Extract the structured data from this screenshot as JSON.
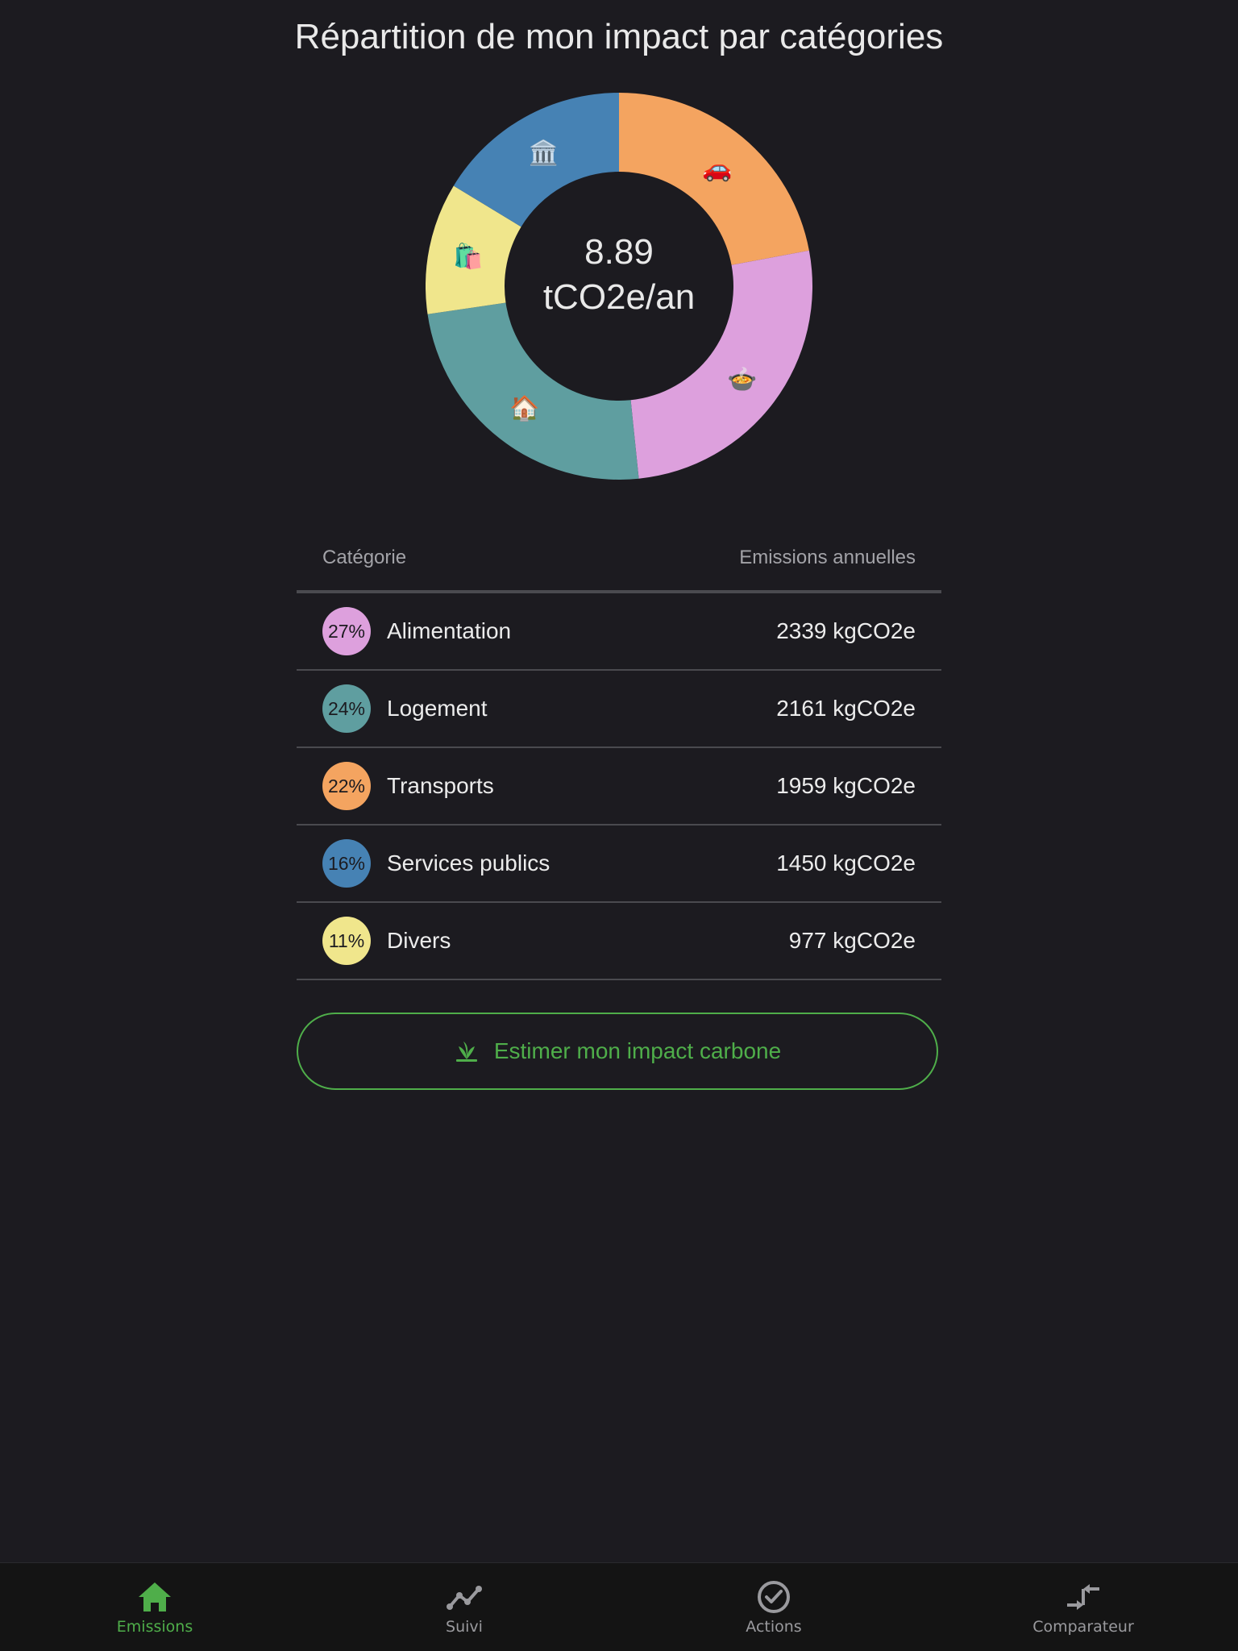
{
  "page": {
    "title": "Répartition de mon impact par catégories"
  },
  "chart_data": {
    "type": "pie",
    "total_line1": "8.89",
    "total_line2": "tCO2e/an",
    "slices": [
      {
        "name": "Transports",
        "value": 1959,
        "color": "#f4a460",
        "icon": "🚗"
      },
      {
        "name": "Alimentation",
        "value": 2339,
        "color": "#dda0dd",
        "icon": "🍲"
      },
      {
        "name": "Logement",
        "value": 2161,
        "color": "#5f9ea0",
        "icon": "🏠"
      },
      {
        "name": "Divers",
        "value": 977,
        "color": "#f0e68c",
        "icon": "🛍️"
      },
      {
        "name": "Services publics",
        "value": 1450,
        "color": "#4682b4",
        "icon": "🏛️"
      }
    ]
  },
  "table": {
    "col_category": "Catégorie",
    "col_emissions": "Emissions annuelles",
    "rows": [
      {
        "pct": "27%",
        "label": "Alimentation",
        "value": "2339 kgCO2e",
        "color": "#dda0dd"
      },
      {
        "pct": "24%",
        "label": "Logement",
        "value": "2161 kgCO2e",
        "color": "#5f9ea0"
      },
      {
        "pct": "22%",
        "label": "Transports",
        "value": "1959 kgCO2e",
        "color": "#f4a460"
      },
      {
        "pct": "16%",
        "label": "Services publics",
        "value": "1450 kgCO2e",
        "color": "#4682b4"
      },
      {
        "pct": "11%",
        "label": "Divers",
        "value": "977 kgCO2e",
        "color": "#f0e68c"
      }
    ]
  },
  "cta": {
    "label": "Estimer mon impact carbone",
    "icon": "sprout-icon",
    "color": "#4fae4a"
  },
  "nav": {
    "items": [
      {
        "label": "Emissions",
        "icon": "home-icon",
        "active": true
      },
      {
        "label": "Suivi",
        "icon": "trend-icon",
        "active": false
      },
      {
        "label": "Actions",
        "icon": "check-circle-icon",
        "active": false
      },
      {
        "label": "Comparateur",
        "icon": "compare-arrows-icon",
        "active": false
      }
    ]
  }
}
